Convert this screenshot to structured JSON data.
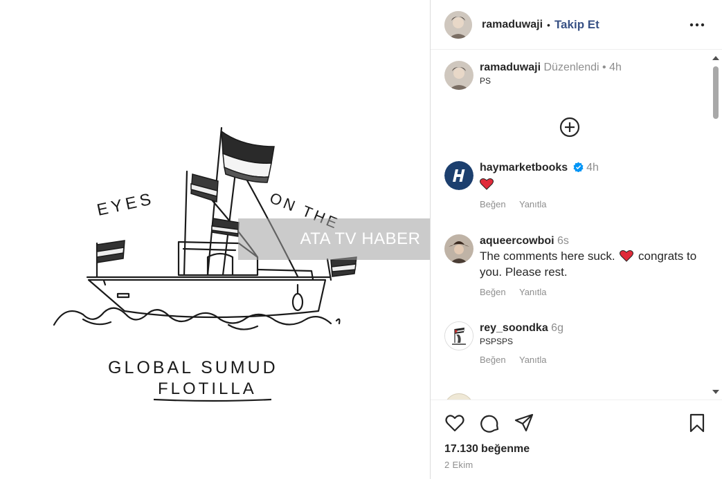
{
  "watermark": {
    "text": "ATA TV HABER"
  },
  "artwork": {
    "top_left_text": "EYES",
    "top_right_text": "ON THE",
    "caption_line1": "GLOBAL SUMUD",
    "caption_line2": "FLOTILLA"
  },
  "header": {
    "username": "ramaduwaji",
    "separator": "•",
    "follow_label": "Takip Et",
    "more_icon": "more-horizontal-icon"
  },
  "caption": {
    "username": "ramaduwaji",
    "edited": "Düzenlendi",
    "separator": "•",
    "time": "4h",
    "text": "PS"
  },
  "load_more_icon": "plus-circle-icon",
  "comments": [
    {
      "username": "haymarketbooks",
      "verified": true,
      "time": "4h",
      "text": "❤️",
      "like_label": "Beğen",
      "reply_label": "Yanıtla"
    },
    {
      "username": "aqueercowboi",
      "verified": false,
      "time": "6s",
      "text_before": "The comments here suck.",
      "text_after": "congrats to you. Please rest.",
      "like_label": "Beğen",
      "reply_label": "Yanıtla"
    },
    {
      "username": "rey_soondka",
      "verified": false,
      "time": "6g",
      "text": "PSPSPS",
      "like_label": "Beğen",
      "reply_label": "Yanıtla"
    }
  ],
  "action_bar": {
    "icons": [
      "heart-icon",
      "comment-icon",
      "share-icon",
      "bookmark-icon"
    ],
    "likes_count": "17.130",
    "likes_label": "beğenme",
    "date": "2 Ekim"
  },
  "colors": {
    "link": "#385185",
    "verified": "#0095f6",
    "heart": "#ed4956",
    "muted": "#8e8e8e"
  }
}
